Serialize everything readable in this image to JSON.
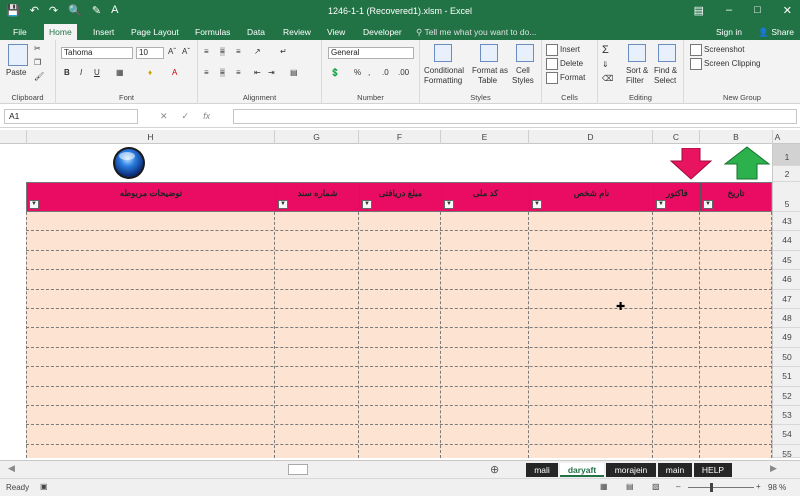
{
  "title": "1246-1-1 (Recovered1).xlsm - Excel",
  "tabs": [
    "File",
    "Home",
    "Insert",
    "Page Layout",
    "Formulas",
    "Data",
    "Review",
    "View",
    "Developer"
  ],
  "tell_me": "Tell me what you want to do...",
  "sign_in": "Sign in",
  "share": "Share",
  "ribbon": {
    "clipboard": {
      "label": "Clipboard",
      "paste": "Paste"
    },
    "font": {
      "label": "Font",
      "name": "Tahoma",
      "size": "10",
      "bold": "B",
      "italic": "I",
      "underline": "U"
    },
    "alignment": {
      "label": "Alignment"
    },
    "number": {
      "label": "Number",
      "format": "General",
      "percent": "%",
      "comma": ","
    },
    "styles": {
      "label": "Styles",
      "conditional": "Conditional",
      "conditional2": "Formatting",
      "format_table": "Format as",
      "format_table2": "Table",
      "cell_styles": "Cell",
      "cell_styles2": "Styles"
    },
    "cells": {
      "label": "Cells",
      "insert": "Insert",
      "delete": "Delete",
      "format": "Format"
    },
    "editing": {
      "label": "Editing",
      "sort": "Sort &",
      "sort2": "Filter",
      "find": "Find &",
      "find2": "Select"
    },
    "newgroup": {
      "label": "New Group",
      "screenshot": "Screenshot",
      "clipping": "Screen Clipping"
    }
  },
  "namebox": "A1",
  "fx": "fx",
  "columns": [
    "H",
    "G",
    "F",
    "E",
    "D",
    "C",
    "B",
    "A"
  ],
  "rows": [
    "1",
    "2",
    "5",
    "43",
    "44",
    "45",
    "46",
    "47",
    "48",
    "49",
    "50",
    "51",
    "52",
    "53",
    "54",
    "55"
  ],
  "table_headers": [
    "توضیحات مربوطه",
    "شماره سند",
    "مبلغ دریافتی",
    "کد ملی",
    "نام شخص",
    "فاکتور",
    "تاریخ"
  ],
  "sheets": [
    "mali",
    "daryaft",
    "morajein",
    "main",
    "HELP"
  ],
  "active_sheet": "daryaft",
  "status": "Ready",
  "zoom": "98 %",
  "colors": {
    "accent": "#217346",
    "header": "#ea0c63",
    "row": "#fde4d2",
    "arrow_down": "#e8145f",
    "arrow_up": "#2db14d"
  },
  "icons": [
    "undo-icon",
    "redo-icon",
    "save-icon",
    "ball-button-icon",
    "arrow-down-icon",
    "arrow-up-icon"
  ]
}
